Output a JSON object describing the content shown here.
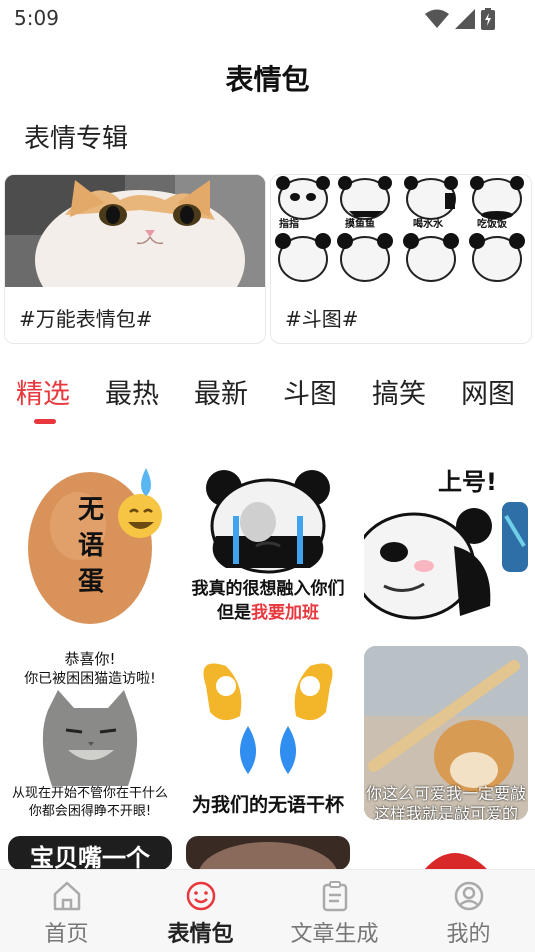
{
  "status": {
    "time": "5:09",
    "icons": [
      "wifi-icon",
      "cell-signal-icon",
      "battery-icon"
    ]
  },
  "header": {
    "title": "表情包"
  },
  "albums": {
    "section_title": "表情专辑",
    "items": [
      {
        "label": "#万能表情包#"
      },
      {
        "label": "#斗图#",
        "panda_texts": [
          "指指",
          "摸鱼鱼",
          "喝水水",
          "吃饭饭"
        ]
      }
    ]
  },
  "tabs": {
    "items": [
      {
        "label": "精选",
        "active": true
      },
      {
        "label": "最热"
      },
      {
        "label": "最新"
      },
      {
        "label": "斗图"
      },
      {
        "label": "搞笑"
      },
      {
        "label": "网图"
      }
    ]
  },
  "stickers": {
    "egg": {
      "text": "无\n语\n蛋",
      "c1": "无",
      "c2": "语",
      "c3": "蛋"
    },
    "panda_cry": {
      "line1": "我真的很想融入你们",
      "line2a": "但是",
      "line2b": "我要加班"
    },
    "panda_up": {
      "text": "上号!"
    },
    "cat": {
      "top1": "恭喜你!",
      "top2": "你已被困困猫造访啦!",
      "bottom1": "从现在开始不管你在干什么",
      "bottom2": "你都会困得睁不开眼!"
    },
    "hands": {
      "caption": "为我们的无语干杯"
    },
    "doge": {
      "line1": "你这么可爱我一定要敲",
      "line2": "这样我就是敲可爱的"
    },
    "baby": {
      "text": "宝贝嘴一个"
    }
  },
  "nav": {
    "items": [
      {
        "label": "首页",
        "icon": "home-icon"
      },
      {
        "label": "表情包",
        "icon": "smiley-icon",
        "active": true
      },
      {
        "label": "文章生成",
        "icon": "document-icon"
      },
      {
        "label": "我的",
        "icon": "profile-icon"
      }
    ]
  },
  "colors": {
    "accent": "#e8383d",
    "nav_bg": "#f7f7f7"
  }
}
